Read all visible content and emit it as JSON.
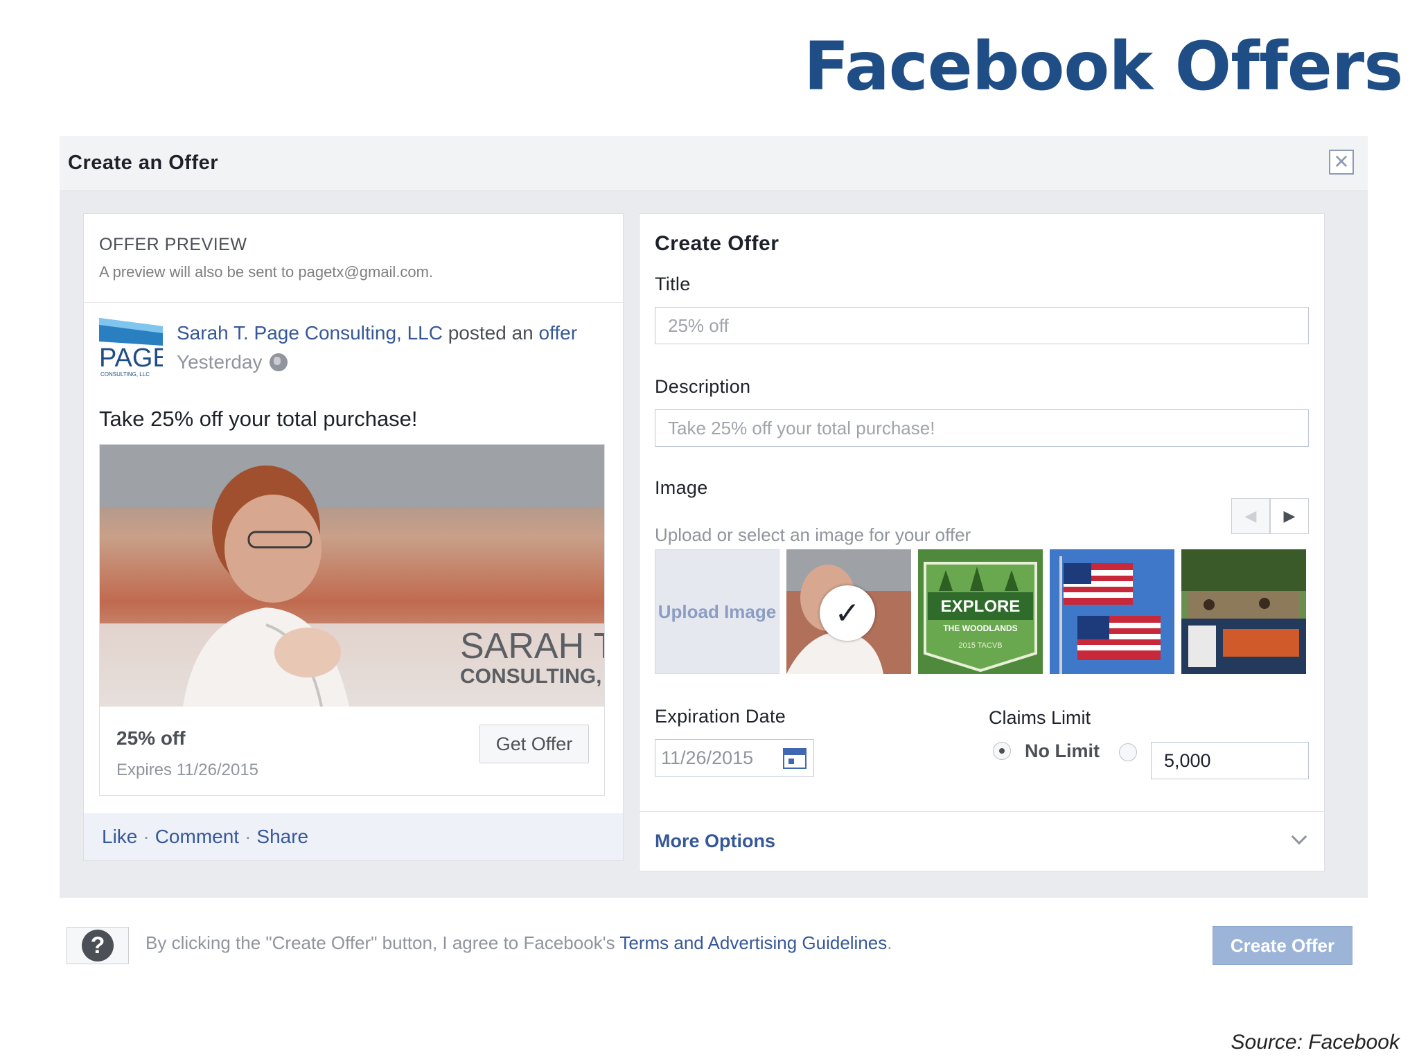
{
  "slide": {
    "title": "Facebook Offers",
    "source": "Source: Facebook"
  },
  "dialog": {
    "title": "Create an Offer",
    "close_icon": "close-icon"
  },
  "preview": {
    "label": "OFFER PREVIEW",
    "note": "A preview will also be sent to pagetx@gmail.com.",
    "post": {
      "page_name": "Sarah T. Page Consulting, LLC",
      "action_text": "posted an",
      "action_link": "offer",
      "time": "Yesterday",
      "message": "Take 25% off your total purchase!",
      "logo_text": "PAGE",
      "logo_subtext": "CONSULTING, LLC",
      "image_overlay_line1": "SARAH T.",
      "image_overlay_line2": "CONSULTING,"
    },
    "offer": {
      "title": "25% off",
      "expires": "Expires 11/26/2015",
      "button": "Get Offer"
    },
    "actions": [
      "Like",
      "Comment",
      "Share"
    ]
  },
  "form": {
    "heading": "Create Offer",
    "title_label": "Title",
    "title_value": "25% off",
    "description_label": "Description",
    "description_value": "Take 25% off your total purchase!",
    "image_label": "Image",
    "image_help": "Upload or select an image for your offer",
    "upload_label": "Upload Image",
    "thumb2_text_line1": "EXPLORE",
    "thumb2_text_line2": "THE WOODLANDS",
    "thumb2_text_line3": "2015 TACVB",
    "expiration_label": "Expiration Date",
    "expiration_value": "11/26/2015",
    "claims_label": "Claims Limit",
    "no_limit_label": "No Limit",
    "limit_value": "5,000",
    "more_options": "More Options"
  },
  "footer": {
    "legal_prefix": "By clicking the \"Create Offer\" button, I agree to Facebook's ",
    "legal_link": "Terms and Advertising Guidelines",
    "legal_suffix": ".",
    "create_button": "Create Offer"
  },
  "colors": {
    "title_blue": "#1f4e87",
    "facebook_link": "#365899",
    "create_button_disabled": "#9cb4d8"
  }
}
